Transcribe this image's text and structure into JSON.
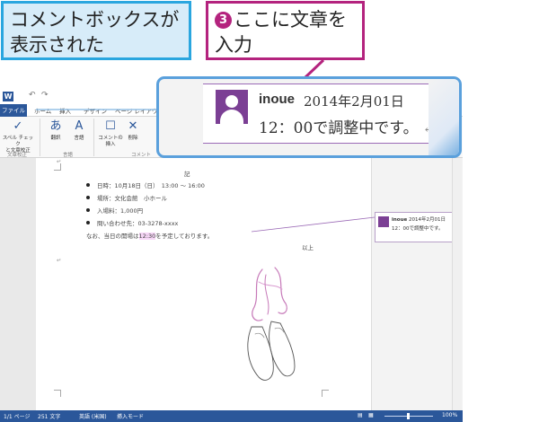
{
  "callouts": {
    "blue": {
      "line1": "コメントボックスが",
      "line2": "表示された"
    },
    "pink": {
      "step": "3",
      "line1": "ここに文章を",
      "line2": "入力"
    }
  },
  "zoom_comment": {
    "author": "inoue",
    "date": "2014年2月01日",
    "text": "12：00で調整中です。",
    "return_mark": "↵"
  },
  "word": {
    "app_icon": "W",
    "qat": {
      "undo": "↶",
      "redo": "↷"
    },
    "tabs": [
      "ファイル",
      "ホーム",
      "挿入",
      "デザイン",
      "ページ レイアウト"
    ],
    "ribbon": {
      "spell_label_1": "スペル チェック",
      "spell_label_2": "と文章校正",
      "translate_label": "翻訳",
      "language_label": "言語",
      "new_comment_label_1": "コメントの",
      "new_comment_label_2": "挿入",
      "delete_label": "削除",
      "group_proofing": "文章校正",
      "group_language": "言語",
      "group_comments": "コメント"
    },
    "document": {
      "heading": "記",
      "bullets": [
        "日時：10月18日（日）　13:00 〜 16:00",
        "場所：文化会館　小ホール",
        "入場料：1,000円",
        "問い合わせ先：03-3278-xxxx"
      ],
      "note_prefix": "なお、当日の開場は",
      "note_highlight": "12:30",
      "note_suffix": "を予定しております。",
      "closing": "以上",
      "paragraph_mark": "↵"
    },
    "side_comment": {
      "author": "inoue",
      "date": "2014年2月01日",
      "text": "12：00で調整中です。"
    },
    "statusbar": {
      "page": "1/1 ページ",
      "words": "251 文字",
      "language": "英語 (米国)",
      "mode": "挿入モード",
      "zoom": "100%"
    }
  }
}
